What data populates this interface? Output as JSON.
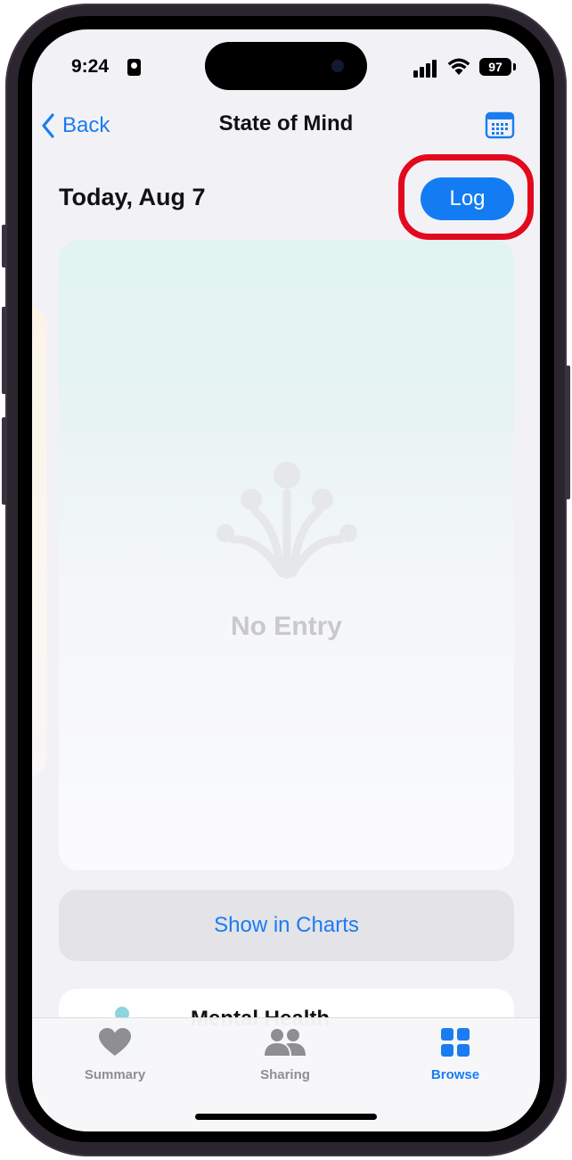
{
  "status": {
    "time": "9:24",
    "battery": "97"
  },
  "nav": {
    "back_label": "Back",
    "title": "State of Mind"
  },
  "header": {
    "date": "Today, Aug 7",
    "log_label": "Log"
  },
  "entry": {
    "empty_text": "No Entry"
  },
  "actions": {
    "show_charts_label": "Show in Charts"
  },
  "card": {
    "label": "Mental Health"
  },
  "tabs": [
    {
      "label": "Summary",
      "icon": "heart-icon",
      "active": false
    },
    {
      "label": "Sharing",
      "icon": "people-icon",
      "active": false
    },
    {
      "label": "Browse",
      "icon": "grid-icon",
      "active": true
    }
  ],
  "colors": {
    "accent": "#147cf2",
    "highlight": "#e3091d",
    "inactive": "#8e8e93"
  }
}
